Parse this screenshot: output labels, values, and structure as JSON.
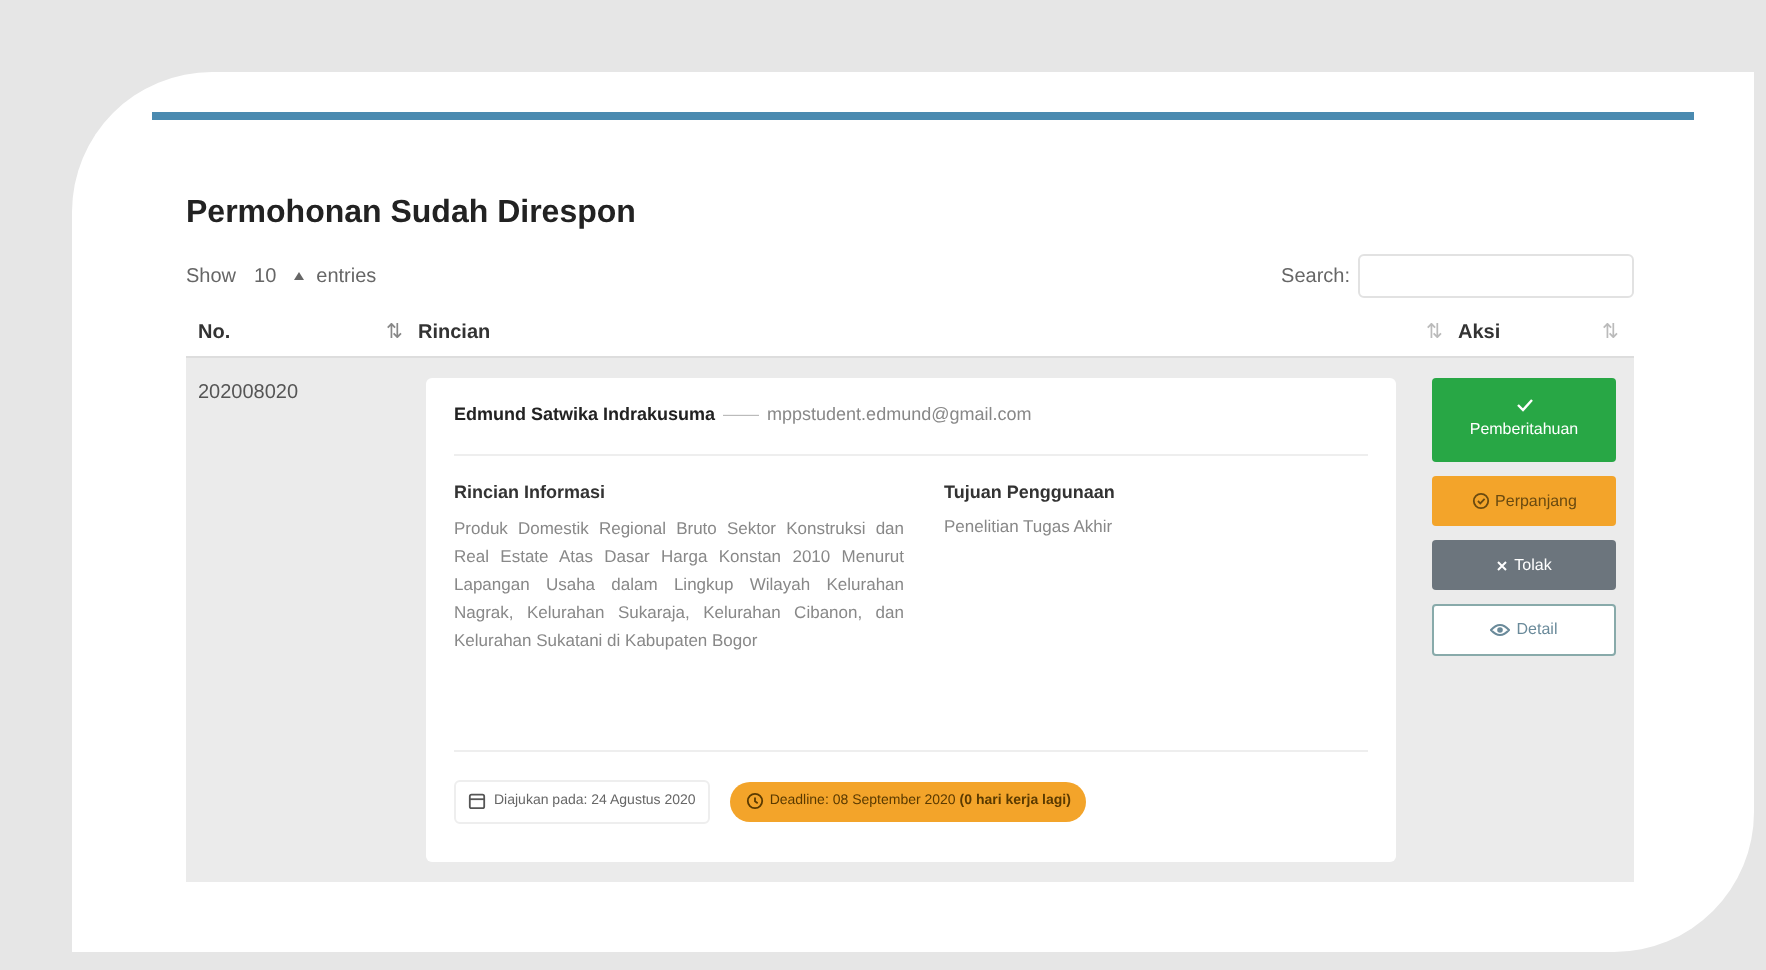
{
  "page_title": "Permohonan Sudah Direspon",
  "length_control": {
    "show": "Show",
    "value": "10",
    "entries": "entries"
  },
  "search": {
    "label": "Search:"
  },
  "table": {
    "columns": [
      {
        "label": "No.",
        "sort": "⇅"
      },
      {
        "label": "Rincian",
        "sort": "⇅"
      },
      {
        "label": "Aksi",
        "sort": "⇅"
      }
    ],
    "rows": [
      {
        "number": "202008020",
        "name": "Edmund Satwika Indrakusuma",
        "separator": "——",
        "email": "mppstudent.edmund@gmail.com",
        "info_title": "Rincian Informasi",
        "info_text": "Produk Domestik Regional Bruto Sektor Konstruksi dan Real Estate Atas Dasar Harga Konstan 2010 Menurut Lapangan Usaha dalam Lingkup Wilayah Kelurahan Nagrak, Kelurahan Sukaraja, Kelurahan Cibanon, dan Kelurahan Sukatani di Kabupaten Bogor",
        "purpose_title": "Tujuan Penggunaan",
        "purpose_text": "Penelitian Tugas Akhir",
        "submitted": "Diajukan pada: 24 Agustus 2020",
        "deadline": "Deadline: 08 September 2020 **(0 hari kerja lagi)**",
        "actions": [
          {
            "kind": "notify",
            "label": "Pemberitahuan"
          },
          {
            "kind": "extend",
            "label": "Perpanjang"
          },
          {
            "kind": "reject",
            "label": "Tolak"
          },
          {
            "kind": "detail",
            "label": "Detail"
          }
        ]
      }
    ]
  }
}
